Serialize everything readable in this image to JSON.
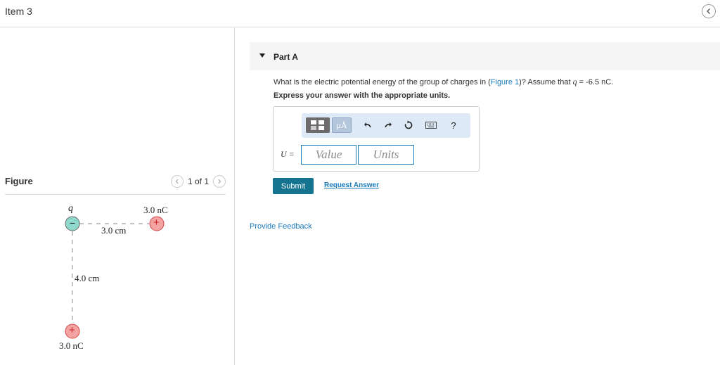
{
  "header": {
    "title": "Item 3"
  },
  "figure": {
    "label": "Figure",
    "pager_text": "1 of 1",
    "charges": {
      "q_label": "q",
      "negative_sign": "−",
      "positive_sign": "+",
      "top_right_charge": "3.0 nC",
      "bottom_charge": "3.0 nC"
    },
    "distances": {
      "horizontal": "3.0 cm",
      "vertical": "4.0 cm"
    },
    "colors": {
      "negative": "#8fd8cc",
      "positive": "#f4a3a3"
    }
  },
  "part": {
    "title": "Part A",
    "question_prefix": "What is the electric potential energy of the group of charges in (",
    "figure_link": "Figure 1",
    "question_mid": ")? Assume that ",
    "q_symbol": "q",
    "q_value": " = -6.5 nC.",
    "instruction": "Express your answer with the appropriate units.",
    "answer_label": "U =",
    "value_placeholder": "Value",
    "units_placeholder": "Units",
    "toolbar": {
      "templates_icon": "templates-icon",
      "units_icon_label": "μÅ",
      "undo_icon": "undo-icon",
      "redo_icon": "redo-icon",
      "reset_icon": "reset-icon",
      "keyboard_icon": "keyboard-icon",
      "help_label": "?"
    },
    "submit_label": "Submit",
    "request_answer_label": "Request Answer"
  },
  "feedback_label": "Provide Feedback",
  "colors": {
    "accent": "#15748f",
    "link": "#1a7bb9",
    "toolbar_bg": "#dde9f7"
  }
}
